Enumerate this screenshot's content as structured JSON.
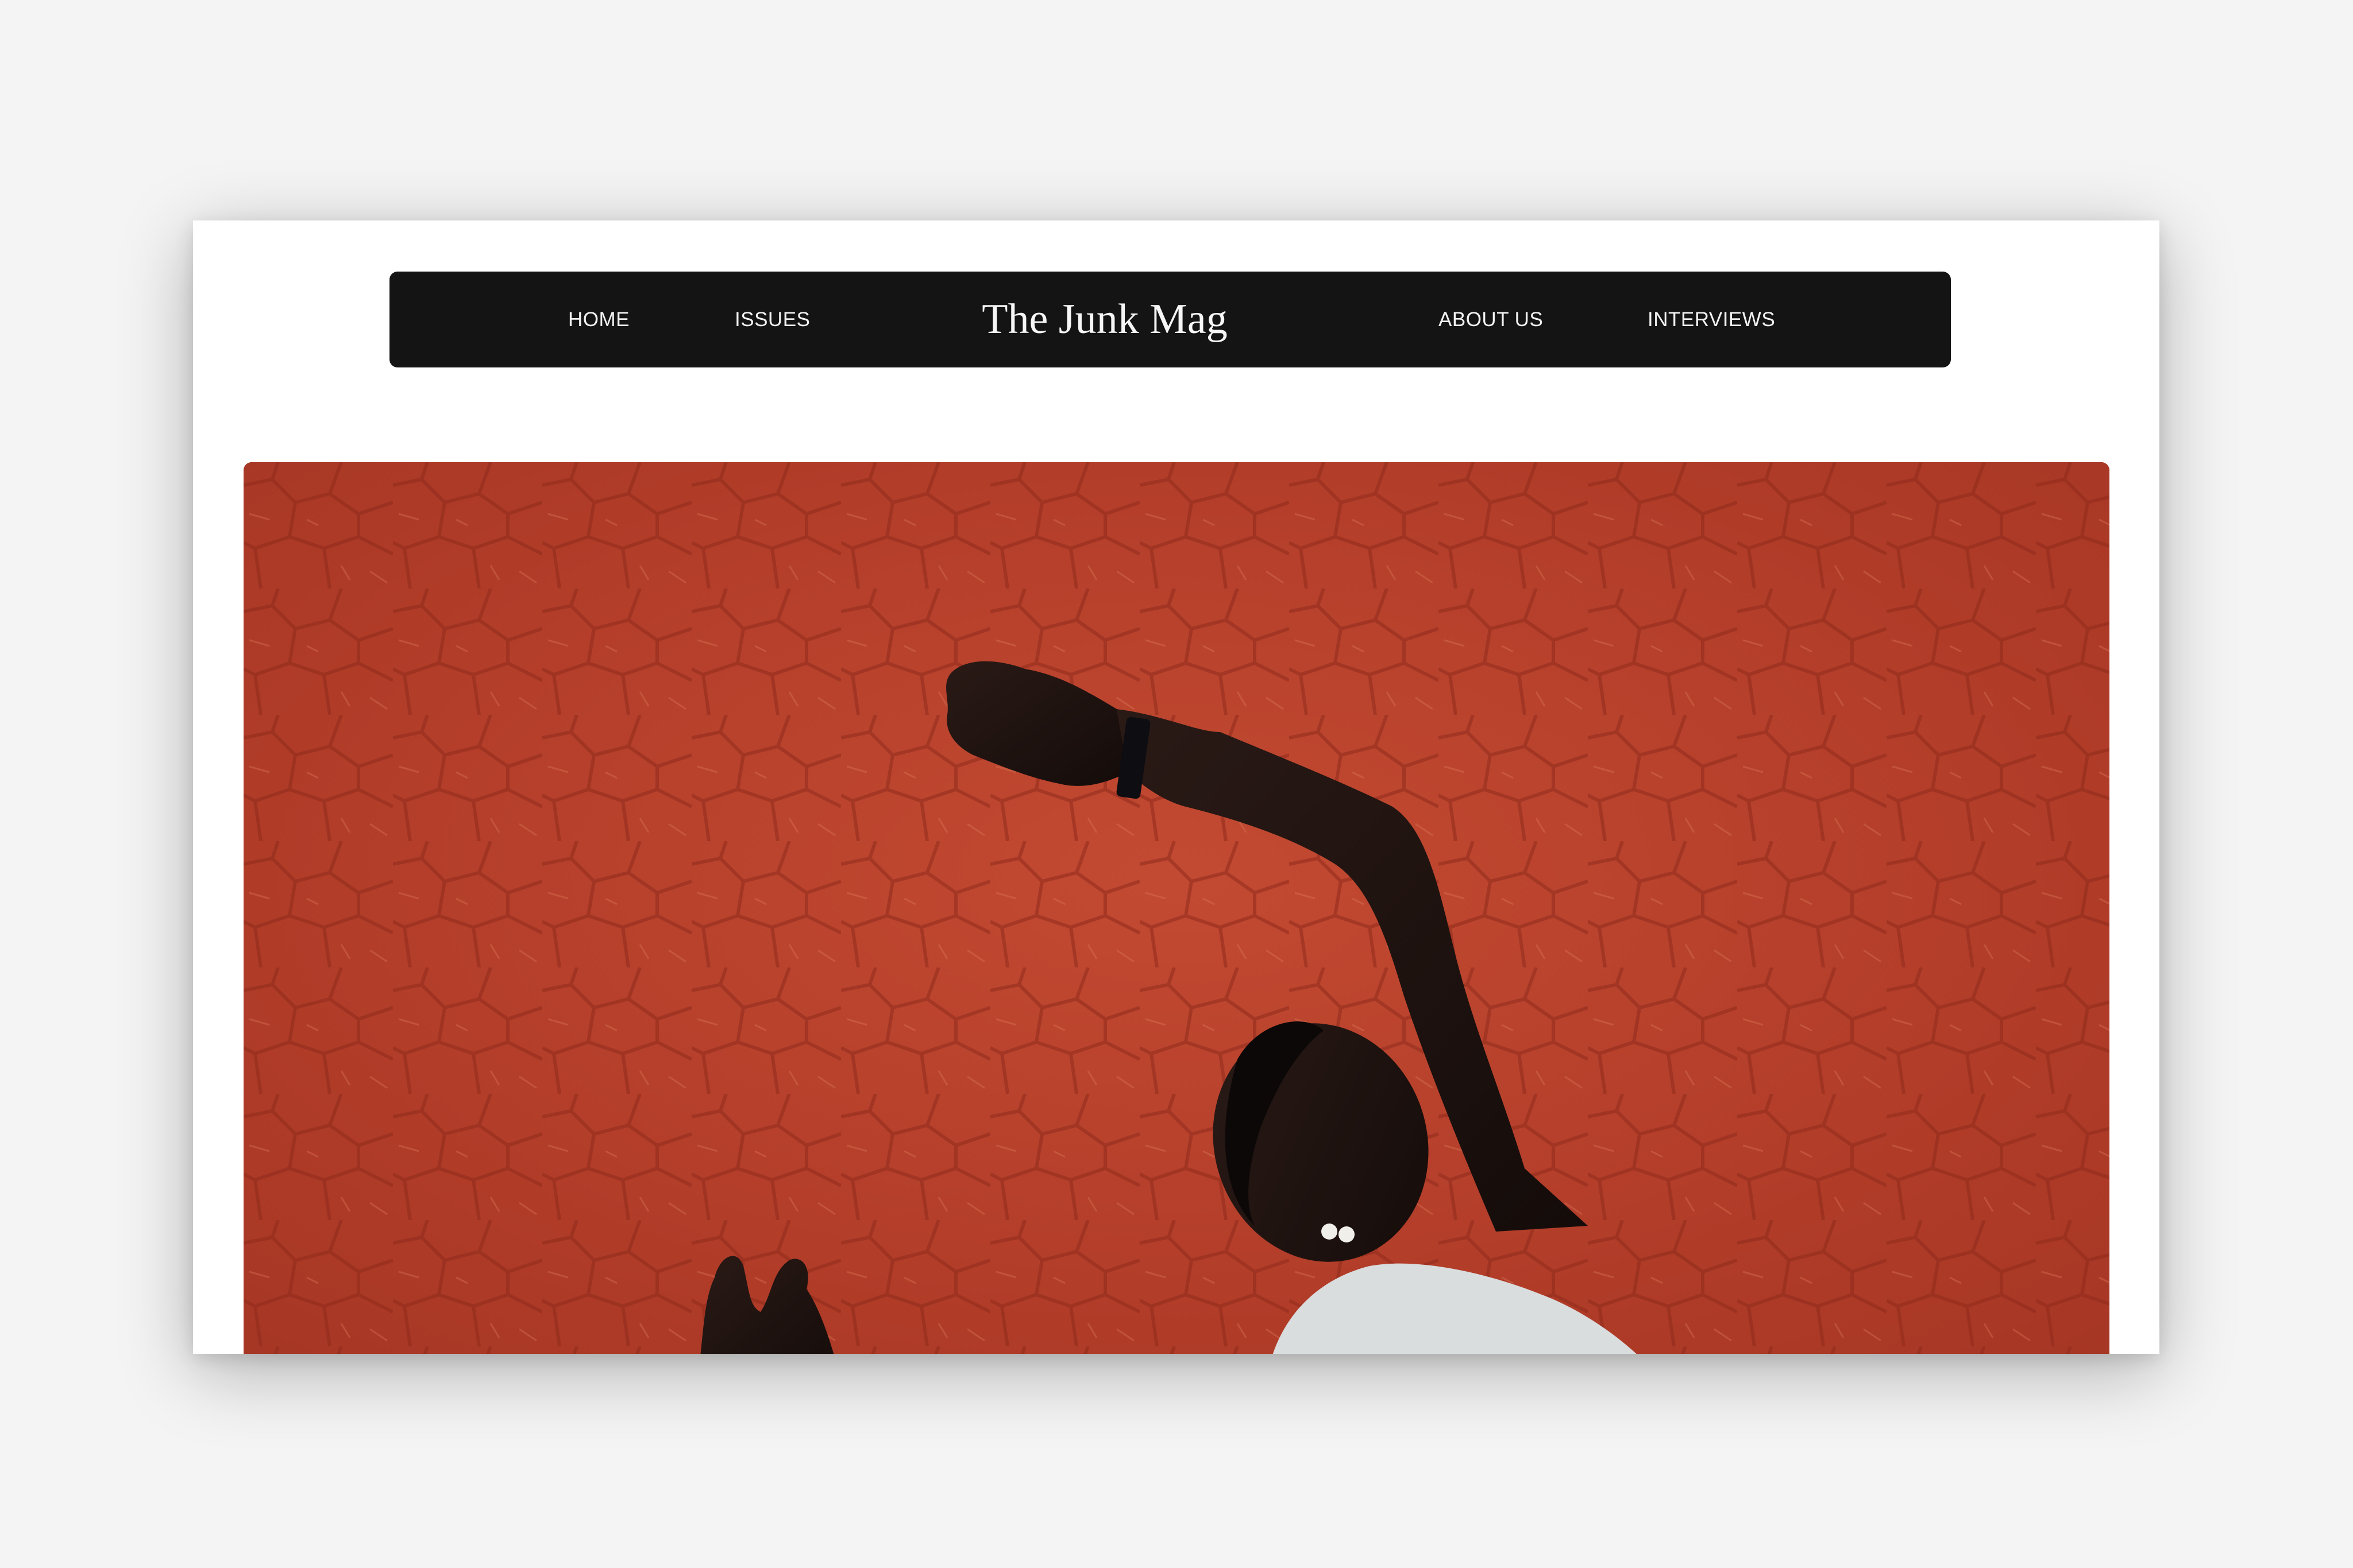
{
  "site": {
    "brand": "The Junk Mag",
    "nav": {
      "left": [
        {
          "label": "HOME"
        },
        {
          "label": "ISSUES"
        }
      ],
      "right": [
        {
          "label": "ABOUT US"
        },
        {
          "label": "INTERVIEWS"
        }
      ]
    }
  },
  "colors": {
    "page_background": "#f4f4f4",
    "navbar_background": "#141414",
    "nav_text": "#f2f2f2",
    "hero_wall": "#b9412b"
  },
  "hero": {
    "image": "person-against-red-cracked-wall-photo"
  }
}
